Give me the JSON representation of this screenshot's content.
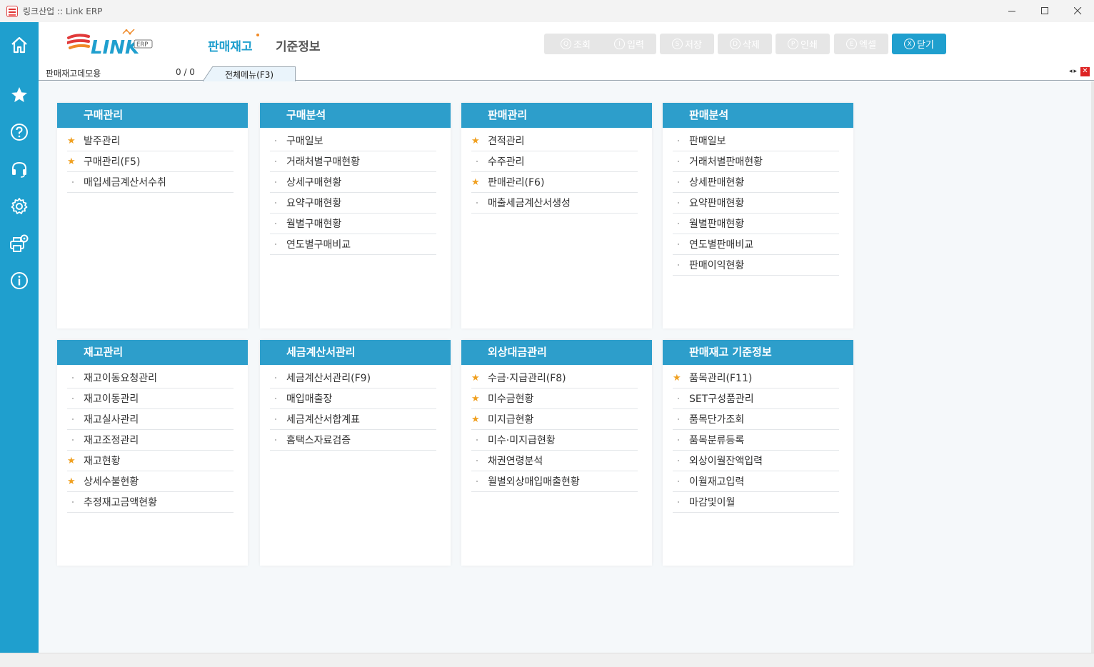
{
  "window": {
    "title": "링크산업 :: Link ERP",
    "controls": [
      "minimize",
      "maximize",
      "close"
    ]
  },
  "header": {
    "logo_text": "LINK",
    "logo_badge": "ERP",
    "nav_active": "판매재고",
    "nav_inactive": "기준정보",
    "toolbar": [
      {
        "key": "Q",
        "label": "조회",
        "enabled": false
      },
      {
        "key": "I",
        "label": "입력",
        "enabled": false
      },
      {
        "key": "S",
        "label": "저장",
        "enabled": false
      },
      {
        "key": "D",
        "label": "삭제",
        "enabled": false
      },
      {
        "key": "P",
        "label": "인쇄",
        "enabled": false
      },
      {
        "key": "E",
        "label": "엑셀",
        "enabled": false
      },
      {
        "key": "X",
        "label": "닫기",
        "enabled": true
      }
    ]
  },
  "tabbar": {
    "page_name": "판매재고데모용",
    "count": "0 / 0",
    "active_tab": "전체메뉴(F3)"
  },
  "sidebar": [
    "home-icon",
    "star-icon",
    "help-icon",
    "headset-icon",
    "gear-icon",
    "printer-settings-icon",
    "info-icon"
  ],
  "cards": [
    {
      "title": "구매관리",
      "items": [
        {
          "label": "발주관리",
          "fav": true
        },
        {
          "label": "구매관리(F5)",
          "fav": true
        },
        {
          "label": "매입세금계산서수취",
          "fav": false
        }
      ]
    },
    {
      "title": "구매분석",
      "items": [
        {
          "label": "구매일보",
          "fav": false
        },
        {
          "label": "거래처별구매현황",
          "fav": false
        },
        {
          "label": "상세구매현황",
          "fav": false
        },
        {
          "label": "요약구매현황",
          "fav": false
        },
        {
          "label": "월별구매현황",
          "fav": false
        },
        {
          "label": "연도별구매비교",
          "fav": false
        }
      ]
    },
    {
      "title": "판매관리",
      "items": [
        {
          "label": "견적관리",
          "fav": true
        },
        {
          "label": "수주관리",
          "fav": false
        },
        {
          "label": "판매관리(F6)",
          "fav": true
        },
        {
          "label": "매출세금계산서생성",
          "fav": false
        }
      ]
    },
    {
      "title": "판매분석",
      "items": [
        {
          "label": "판매일보",
          "fav": false
        },
        {
          "label": "거래처별판매현황",
          "fav": false
        },
        {
          "label": "상세판매현황",
          "fav": false
        },
        {
          "label": "요약판매현황",
          "fav": false
        },
        {
          "label": "월별판매현황",
          "fav": false
        },
        {
          "label": "연도별판매비교",
          "fav": false
        },
        {
          "label": "판매이익현황",
          "fav": false
        }
      ]
    },
    {
      "title": "재고관리",
      "items": [
        {
          "label": "재고이동요청관리",
          "fav": false
        },
        {
          "label": "재고이동관리",
          "fav": false
        },
        {
          "label": "재고실사관리",
          "fav": false
        },
        {
          "label": "재고조정관리",
          "fav": false
        },
        {
          "label": "재고현황",
          "fav": true
        },
        {
          "label": "상세수불현황",
          "fav": true
        },
        {
          "label": "추정재고금액현황",
          "fav": false
        }
      ]
    },
    {
      "title": "세금계산서관리",
      "items": [
        {
          "label": "세금계산서관리(F9)",
          "fav": false
        },
        {
          "label": "매입매출장",
          "fav": false
        },
        {
          "label": "세금계산서합계표",
          "fav": false
        },
        {
          "label": "홈택스자료검증",
          "fav": false
        }
      ]
    },
    {
      "title": "외상대금관리",
      "items": [
        {
          "label": "수금·지급관리(F8)",
          "fav": true
        },
        {
          "label": "미수금현황",
          "fav": true
        },
        {
          "label": "미지급현황",
          "fav": true
        },
        {
          "label": "미수·미지급현황",
          "fav": false
        },
        {
          "label": "채권연령분석",
          "fav": false
        },
        {
          "label": "월별외상매입매출현황",
          "fav": false
        }
      ]
    },
    {
      "title": "판매재고 기준정보",
      "items": [
        {
          "label": "품목관리(F11)",
          "fav": true
        },
        {
          "label": "SET구성품관리",
          "fav": false
        },
        {
          "label": "품목단가조회",
          "fav": false
        },
        {
          "label": "품목분류등록",
          "fav": false
        },
        {
          "label": "외상이월잔액입력",
          "fav": false
        },
        {
          "label": "이월재고입력",
          "fav": false
        },
        {
          "label": "마감및이월",
          "fav": false
        }
      ]
    }
  ]
}
